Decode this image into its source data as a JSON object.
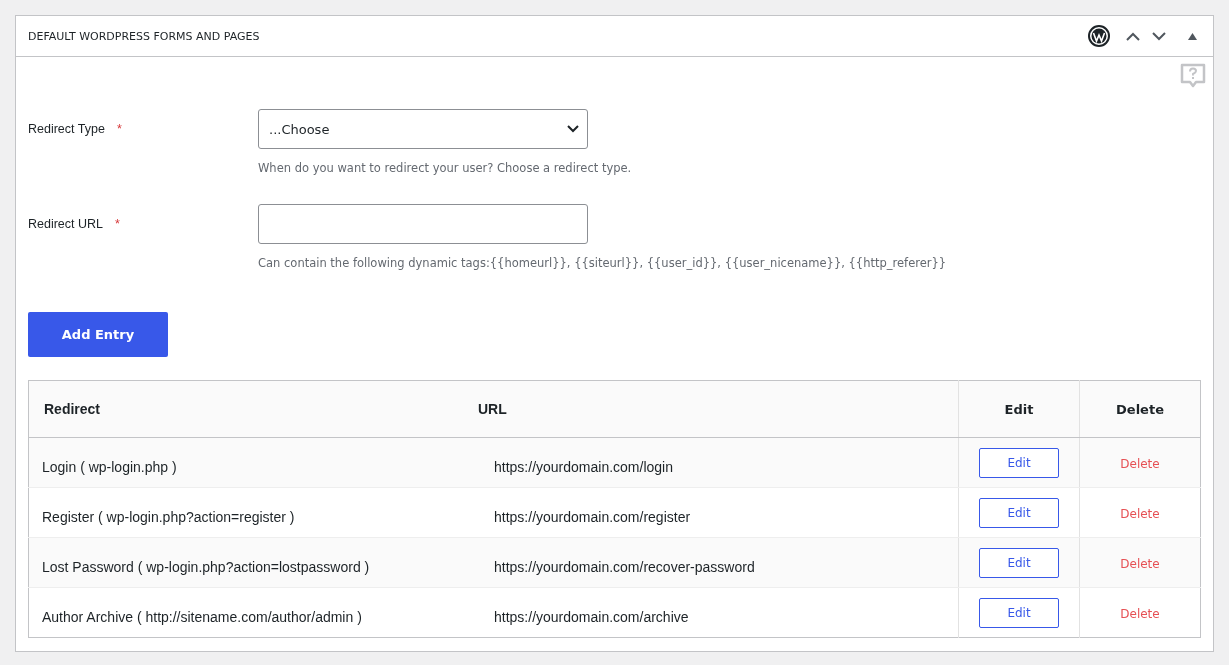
{
  "panel": {
    "title": "DEFAULT WORDPRESS FORMS AND PAGES"
  },
  "form": {
    "fields": [
      {
        "kind": "select",
        "label": "Redirect Type",
        "required_mark": "*",
        "value": "...Choose",
        "help": "When do you want to redirect your user? Choose a redirect type."
      },
      {
        "kind": "text",
        "label": "Redirect URL",
        "required_mark": "*",
        "help": "Can contain the following dynamic tags:{{homeurl}}, {{siteurl}}, {{user_id}}, {{user_nicename}}, {{http_referer}}"
      }
    ],
    "submit": "Add Entry"
  },
  "table": {
    "columns": [
      "Redirect",
      "URL",
      "Edit",
      "Delete"
    ],
    "rows": [
      {
        "redirect": "Login ( wp-login.php )",
        "url": "https://yourdomain.com/login",
        "edit": "Edit",
        "delete": "Delete"
      },
      {
        "redirect": "Register ( wp-login.php?action=register )",
        "url": "https://yourdomain.com/register",
        "edit": "Edit",
        "delete": "Delete"
      },
      {
        "redirect": "Lost Password ( wp-login.php?action=lostpassword )",
        "url": "https://yourdomain.com/recover-password",
        "edit": "Edit",
        "delete": "Delete"
      },
      {
        "redirect": "Author Archive ( http://sitename.com/author/admin )",
        "url": "https://yourdomain.com/archive",
        "edit": "Edit",
        "delete": "Delete"
      }
    ]
  }
}
